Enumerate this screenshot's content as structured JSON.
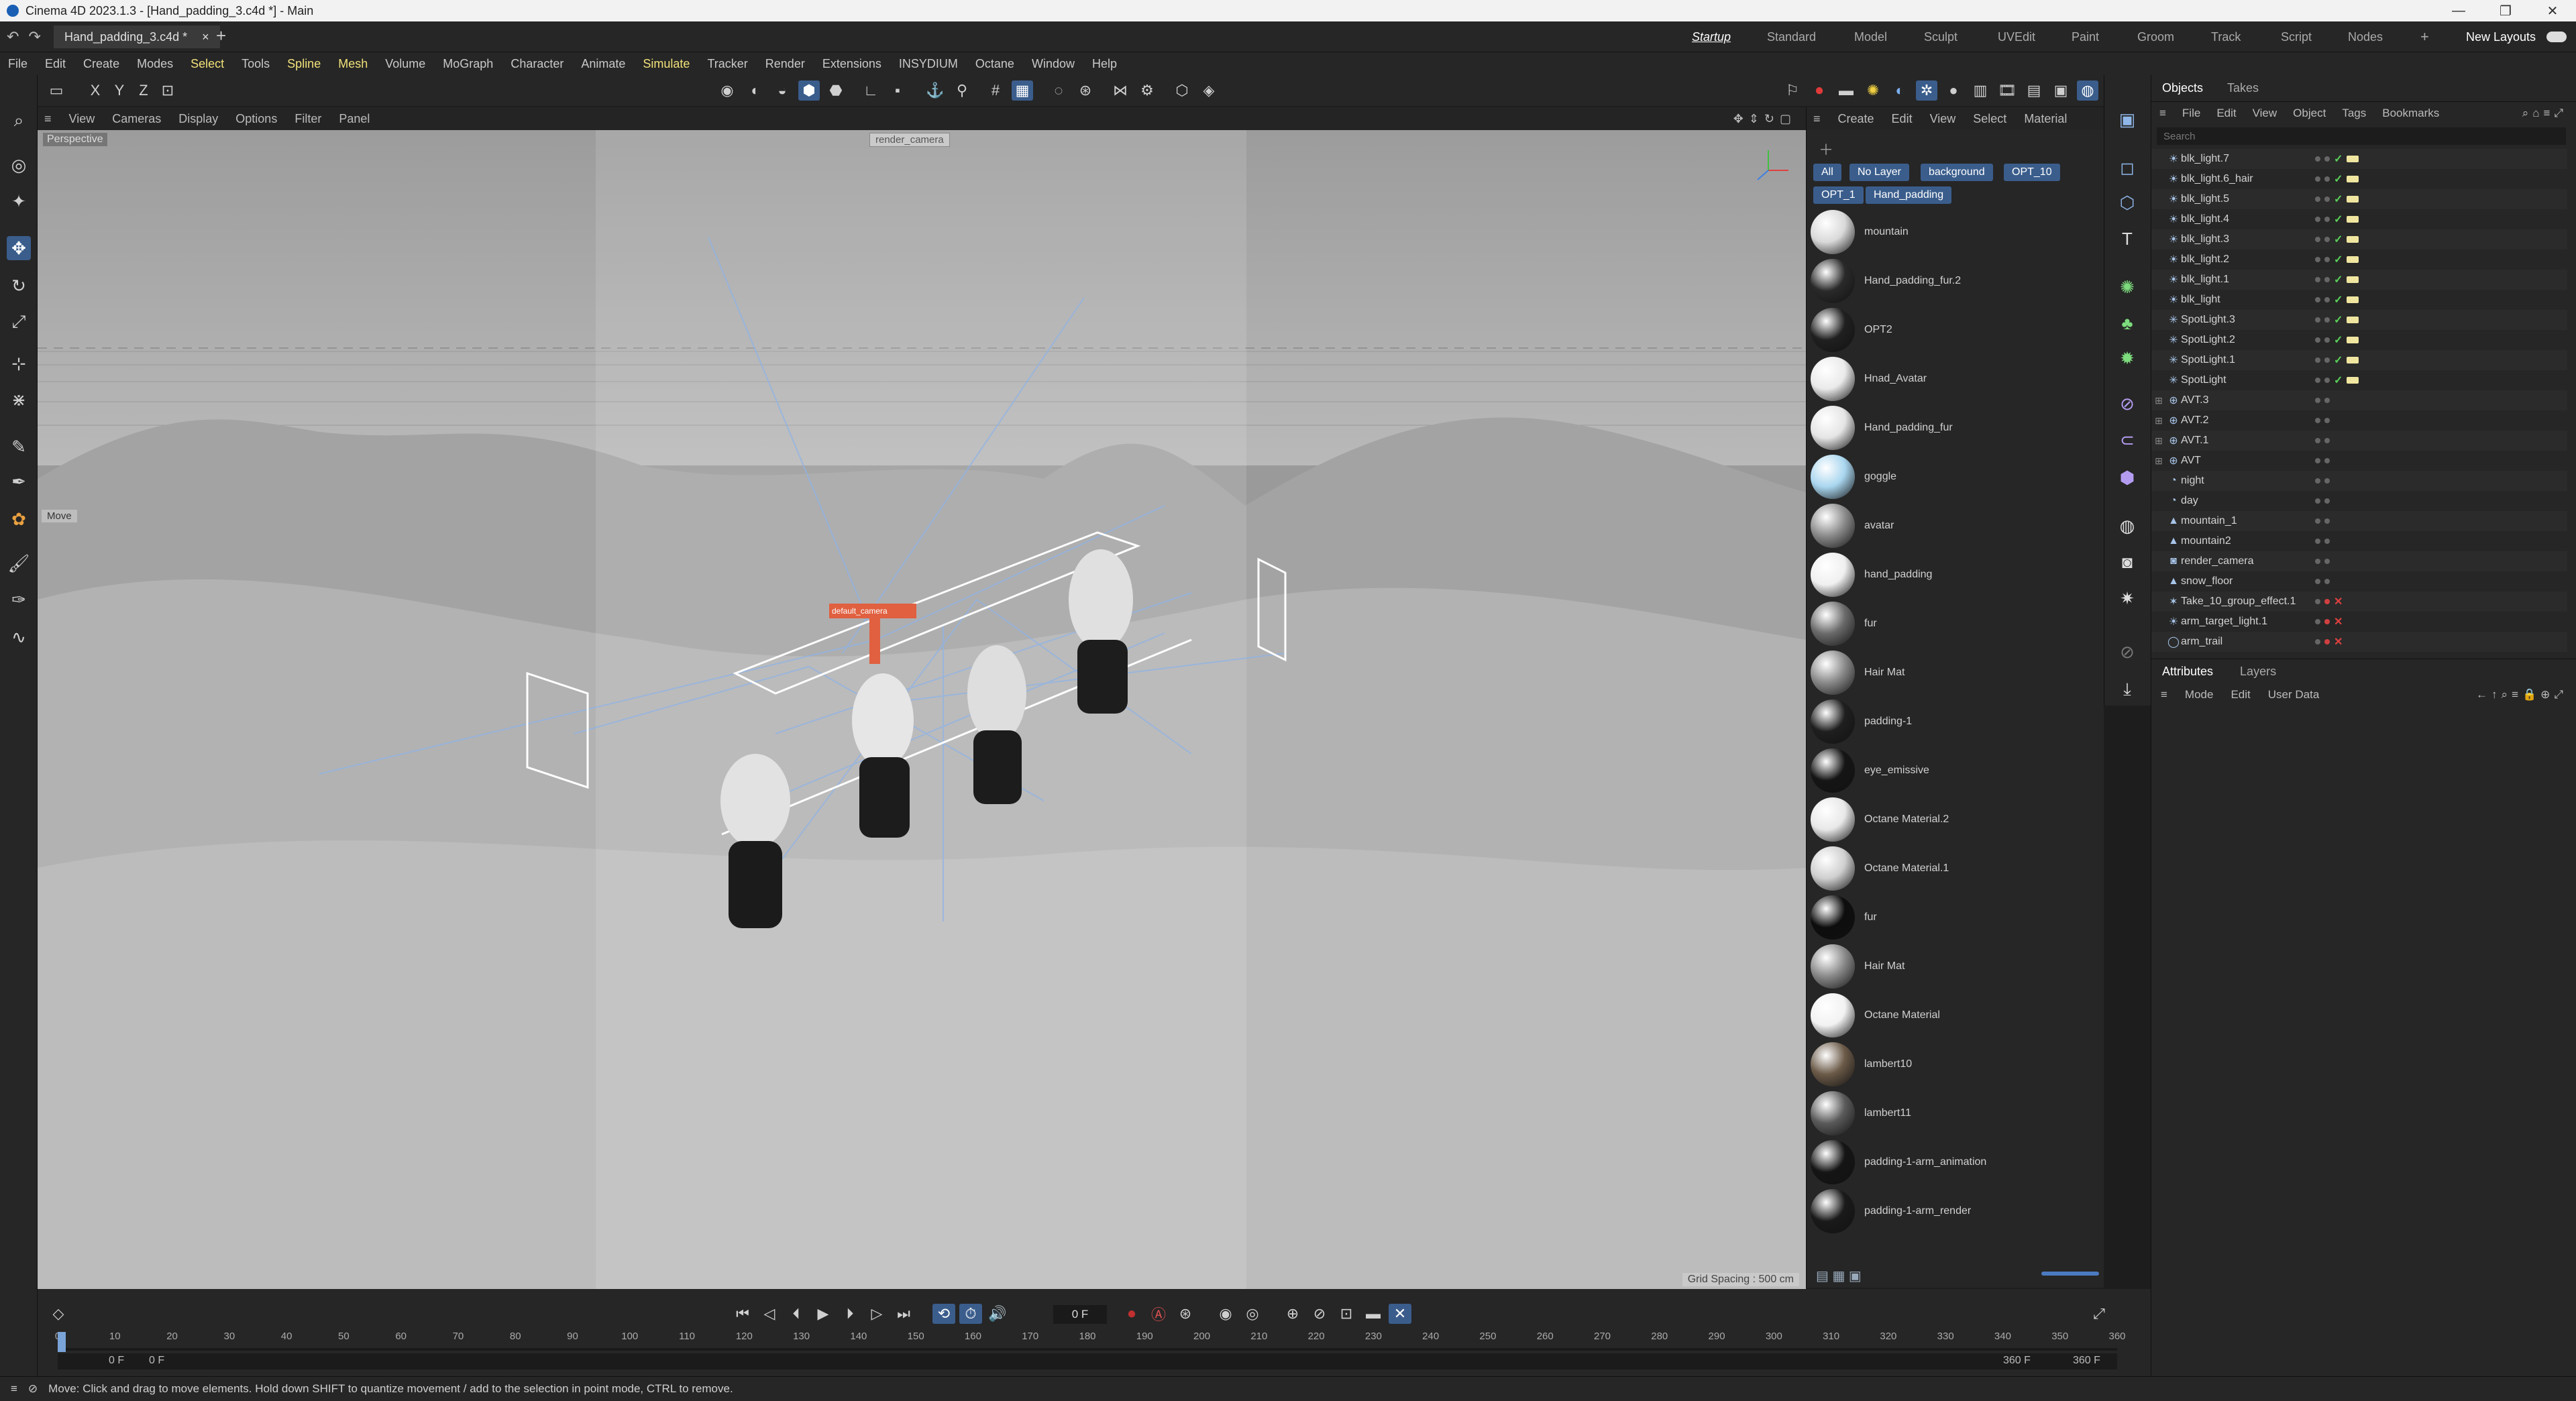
{
  "window": {
    "title": "Cinema 4D 2023.1.3 - [Hand_padding_3.c4d *] - Main",
    "controls": [
      "—",
      "❐",
      "✕"
    ]
  },
  "document_tab": {
    "label": "Hand_padding_3.c4d *",
    "close": "×",
    "new": "+"
  },
  "layouts": {
    "items": [
      "Startup",
      "Standard",
      "Model",
      "Sculpt",
      "UVEdit",
      "Paint",
      "Groom",
      "Track",
      "Script",
      "Nodes"
    ],
    "active": "Startup",
    "new_layouts": "New Layouts",
    "add": "+"
  },
  "menu": [
    "File",
    "Edit",
    "Create",
    "Modes",
    "Select",
    "Tools",
    "Spline",
    "Mesh",
    "Volume",
    "MoGraph",
    "Character",
    "Animate",
    "Simulate",
    "Tracker",
    "Render",
    "Extensions",
    "INSYDIUM",
    "Octane",
    "Window",
    "Help"
  ],
  "menu_highlight": [
    "Select",
    "Spline",
    "Mesh",
    "Simulate"
  ],
  "viewport": {
    "menu": [
      "View",
      "Cameras",
      "Display",
      "Options",
      "Filter",
      "Panel"
    ],
    "view_name": "Perspective",
    "camera_label": "render_camera",
    "grid_spacing": "Grid Spacing : 500 cm",
    "tool_label": "Move",
    "callout": "default_camera"
  },
  "materials": {
    "menu": [
      "Create",
      "Edit",
      "View",
      "Select",
      "Material"
    ],
    "filters": [
      "All",
      "No Layer",
      "background",
      "OPT_10",
      "OPT_1",
      "Hand_padding"
    ],
    "items": [
      {
        "name": "mountain",
        "color": "#d9d9d9"
      },
      {
        "name": "Hand_padding_fur.2",
        "color": "#2a2a2a"
      },
      {
        "name": "OPT2",
        "color": "#202020"
      },
      {
        "name": "Hnad_Avatar",
        "color": "#eaeaea"
      },
      {
        "name": "Hand_padding_fur",
        "color": "#e5e5e5"
      },
      {
        "name": "goggle",
        "color": "#a9d6ef"
      },
      {
        "name": "avatar",
        "color": "#8c8c8c"
      },
      {
        "name": "hand_padding",
        "color": "#f0f0f0"
      },
      {
        "name": "fur",
        "color": "#6a6a6a"
      },
      {
        "name": "Hair Mat",
        "color": "#8a8a8a"
      },
      {
        "name": "padding-1",
        "color": "#1f1f1f"
      },
      {
        "name": "eye_emissive",
        "color": "#151515"
      },
      {
        "name": "Octane Material.2",
        "color": "#e8e8e8"
      },
      {
        "name": "Octane Material.1",
        "color": "#cfcfcf"
      },
      {
        "name": "fur",
        "color": "#0d0d0d"
      },
      {
        "name": "Hair Mat",
        "color": "#8a8a8a"
      },
      {
        "name": "Octane Material",
        "color": "#f2f2f2"
      },
      {
        "name": "lambert10",
        "color": "#6b5a48"
      },
      {
        "name": "lambert11",
        "color": "#5a5a5a"
      },
      {
        "name": "padding-1-arm_animation",
        "color": "#151515"
      },
      {
        "name": "padding-1-arm_render",
        "color": "#1a1a1a"
      }
    ]
  },
  "objects": {
    "tabs": [
      "Objects",
      "Takes"
    ],
    "menu": [
      "File",
      "Edit",
      "View",
      "Object",
      "Tags",
      "Bookmarks"
    ],
    "search_placeholder": "Search",
    "items": [
      {
        "name": "blk_light.7",
        "icon": "light-icon",
        "state": "check"
      },
      {
        "name": "blk_light.6_hair",
        "icon": "light-icon",
        "state": "check"
      },
      {
        "name": "blk_light.5",
        "icon": "light-icon",
        "state": "check"
      },
      {
        "name": "blk_light.4",
        "icon": "light-icon",
        "state": "check"
      },
      {
        "name": "blk_light.3",
        "icon": "light-icon",
        "state": "check"
      },
      {
        "name": "blk_light.2",
        "icon": "light-icon",
        "state": "check"
      },
      {
        "name": "blk_light.1",
        "icon": "light-icon",
        "state": "check"
      },
      {
        "name": "blk_light",
        "icon": "light-icon",
        "state": "check"
      },
      {
        "name": "SpotLight.3",
        "icon": "spotlight-icon",
        "state": "check"
      },
      {
        "name": "SpotLight.2",
        "icon": "spotlight-icon",
        "state": "check"
      },
      {
        "name": "SpotLight.1",
        "icon": "spotlight-icon",
        "state": "check"
      },
      {
        "name": "SpotLight",
        "icon": "spotlight-icon",
        "state": "check"
      },
      {
        "name": "AVT.3",
        "icon": "null-icon",
        "state": "none"
      },
      {
        "name": "AVT.2",
        "icon": "null-icon",
        "state": "none"
      },
      {
        "name": "AVT.1",
        "icon": "null-icon",
        "state": "none"
      },
      {
        "name": "AVT",
        "icon": "null-icon",
        "state": "none"
      },
      {
        "name": "night",
        "icon": "sky-icon",
        "state": "none"
      },
      {
        "name": "day",
        "icon": "sky-icon",
        "state": "none"
      },
      {
        "name": "mountain_1",
        "icon": "mesh-icon",
        "state": "none"
      },
      {
        "name": "mountain2",
        "icon": "mesh-icon",
        "state": "none"
      },
      {
        "name": "render_camera",
        "icon": "camera-icon",
        "state": "none"
      },
      {
        "name": "snow_floor",
        "icon": "mesh-icon",
        "state": "none"
      },
      {
        "name": "Take_10_group_effect.1",
        "icon": "effector-icon",
        "state": "cross"
      },
      {
        "name": "arm_target_light.1",
        "icon": "light-icon",
        "state": "cross"
      },
      {
        "name": "arm_trail",
        "icon": "spline-icon",
        "state": "cross"
      }
    ]
  },
  "attributes": {
    "tabs": [
      "Attributes",
      "Layers"
    ],
    "menu": [
      "Mode",
      "Edit",
      "User Data"
    ]
  },
  "timeline": {
    "current_frame": "0 F",
    "ticks": [
      "0",
      "10",
      "20",
      "30",
      "40",
      "50",
      "60",
      "70",
      "80",
      "90",
      "100",
      "110",
      "120",
      "130",
      "140",
      "150",
      "160",
      "170",
      "180",
      "190",
      "200",
      "210",
      "220",
      "230",
      "240",
      "250",
      "260",
      "270",
      "280",
      "290",
      "300",
      "310",
      "320",
      "330",
      "340",
      "350",
      "360"
    ],
    "start_field": "0 F",
    "range_start": "0 F",
    "range_end": "360 F",
    "end_field": "360 F"
  },
  "status": "Move: Click and drag to move elements. Hold down SHIFT to quantize movement / add to the selection in point mode, CTRL to remove."
}
